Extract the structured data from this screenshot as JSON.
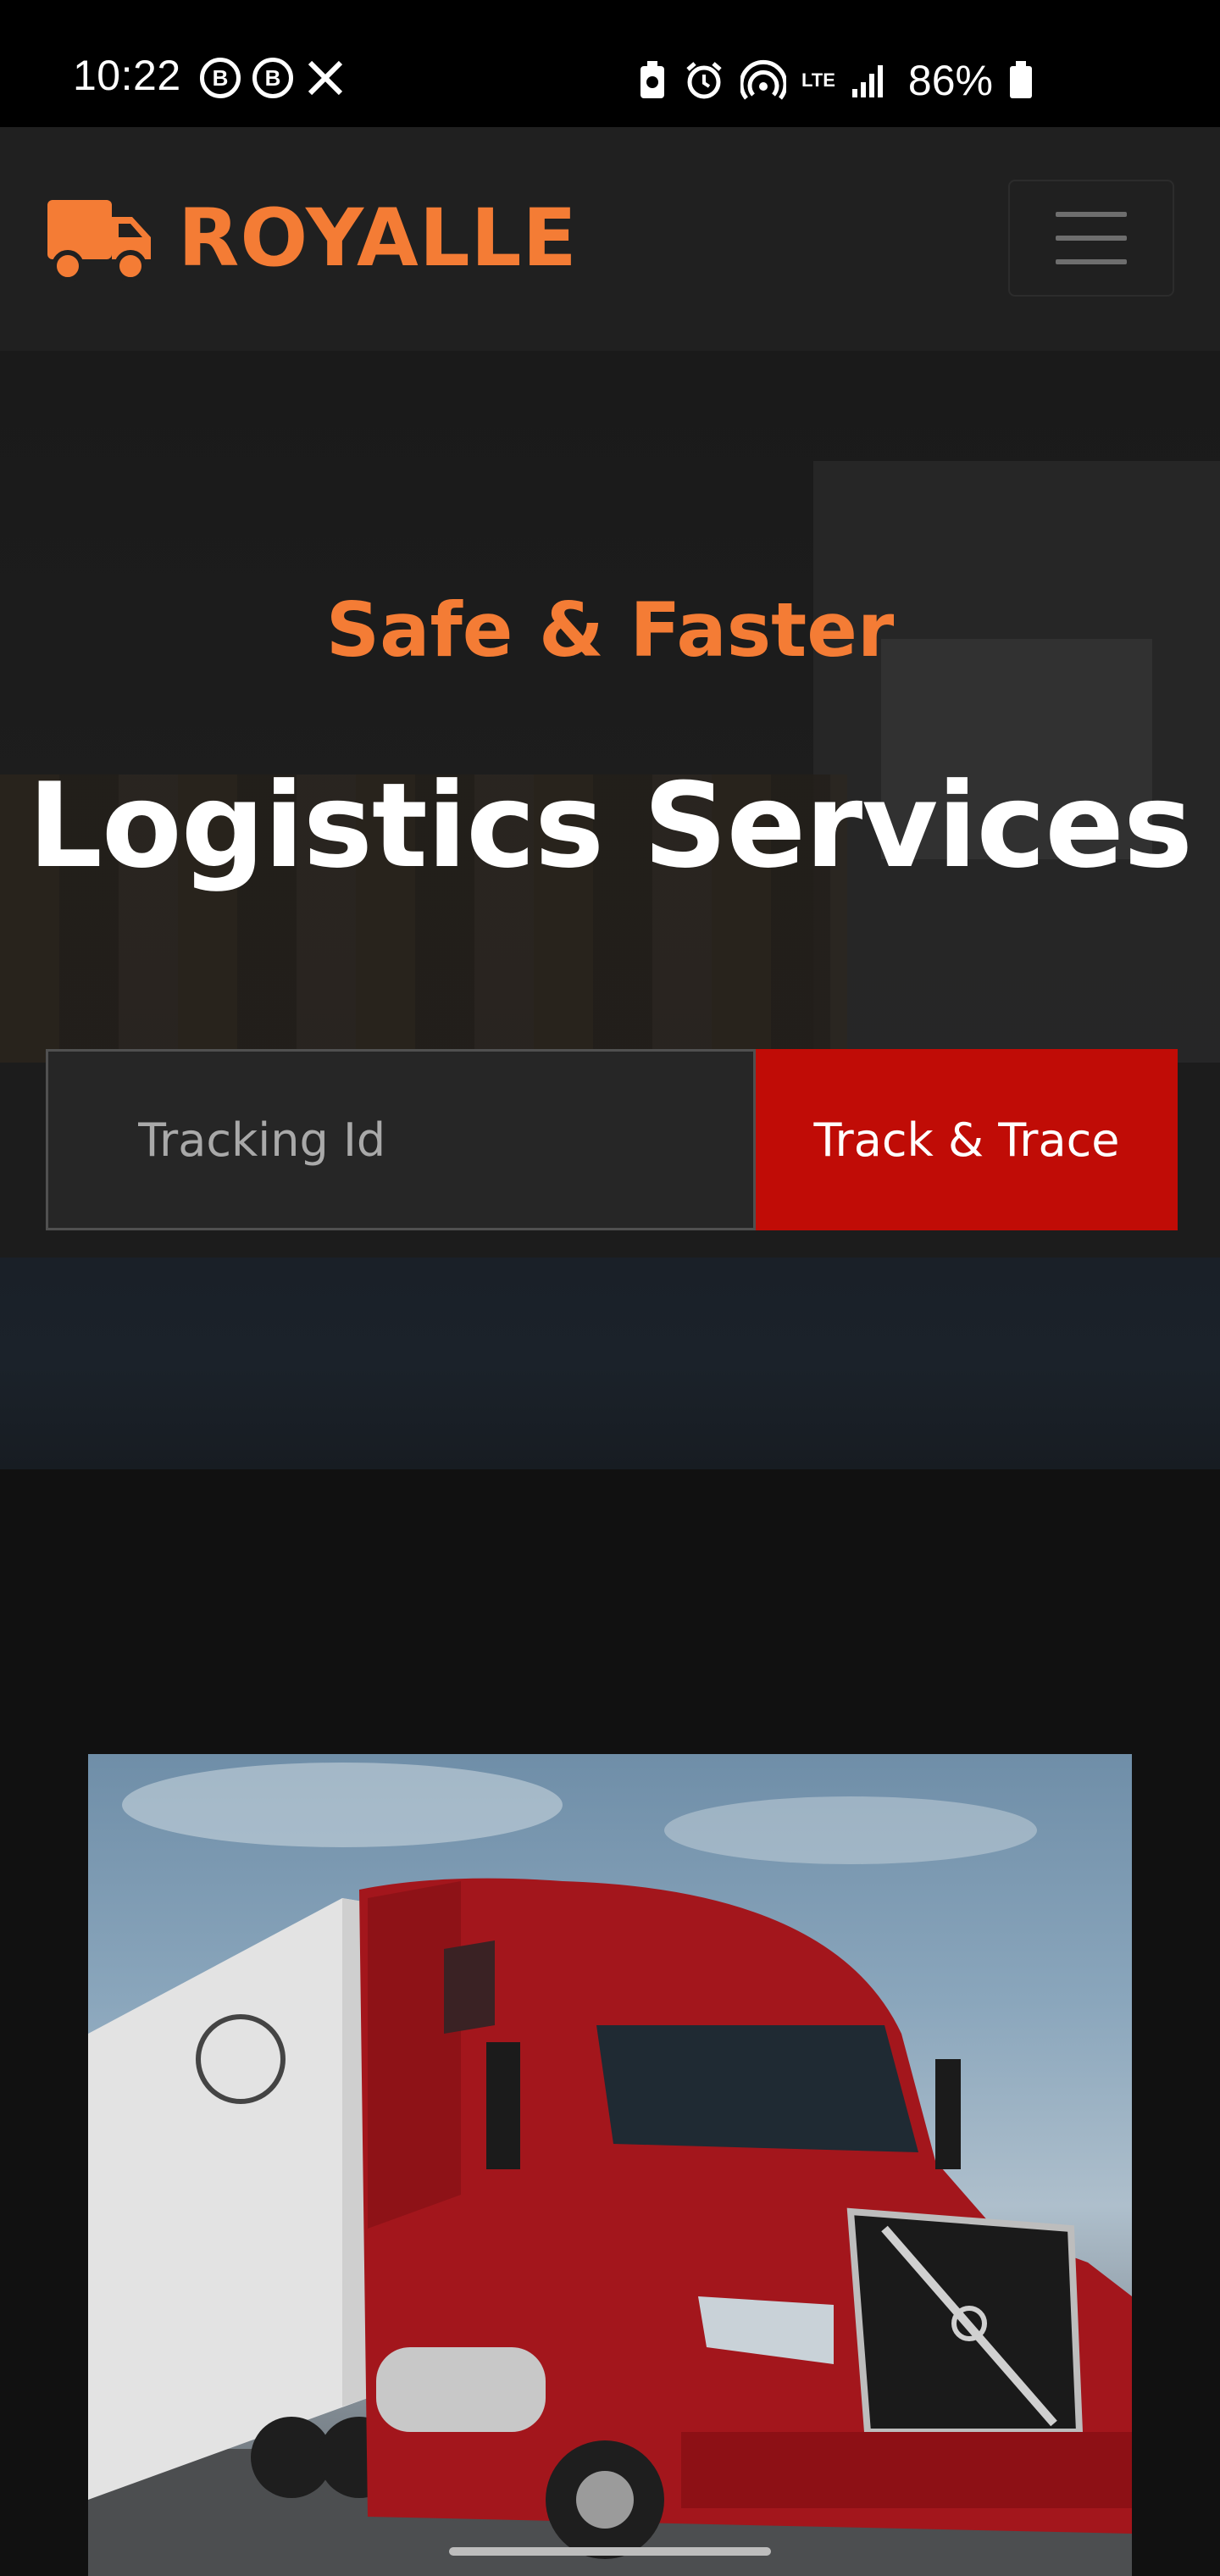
{
  "status_bar": {
    "time": "10:22",
    "left_icons": [
      "b-circle-icon",
      "b-circle-icon",
      "x-logo-icon"
    ],
    "right_icons": [
      "battery-saver-icon",
      "alarm-icon",
      "hotspot-icon",
      "lte-signal-icon",
      "signal-bars-icon"
    ],
    "lte_label": "LTE",
    "battery_percent": "86%"
  },
  "navbar": {
    "brand_name": "ROYALLE",
    "brand_icon": "truck-icon",
    "accent_color": "#f47c35",
    "menu_icon": "hamburger-menu-icon"
  },
  "hero": {
    "subtitle": "Safe & Faster",
    "title": "Logistics Services",
    "tracking_placeholder": "Tracking Id",
    "track_button_label": "Track & Trace",
    "button_color": "#c00c06"
  },
  "content": {
    "image_subject": "red semi-truck"
  }
}
